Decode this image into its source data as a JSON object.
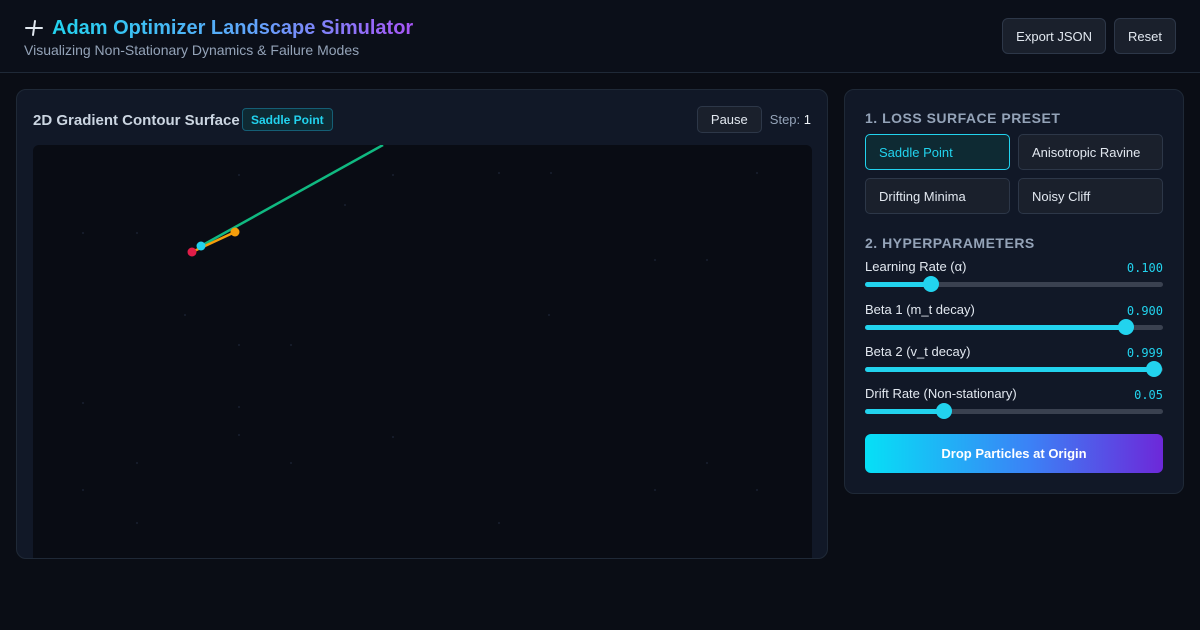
{
  "header": {
    "title": "Adam Optimizer Landscape Simulator",
    "subtitle": "Visualizing Non-Stationary Dynamics & Failure Modes",
    "export_label": "Export JSON",
    "reset_label": "Reset",
    "icon": "plane-icon"
  },
  "canvas_panel": {
    "title": "2D Gradient Contour Surface",
    "badge": "Saddle Point",
    "pause_label": "Pause",
    "step_label": "Step:",
    "step_value": "1"
  },
  "controls": {
    "preset_section_title": "1. LOSS SURFACE PRESET",
    "presets": [
      {
        "label": "Saddle Point",
        "active": true
      },
      {
        "label": "Anisotropic Ravine",
        "active": false
      },
      {
        "label": "Drifting Minima",
        "active": false
      },
      {
        "label": "Noisy Cliff",
        "active": false
      }
    ],
    "hyper_section_title": "2. HYPERPARAMETERS",
    "params": [
      {
        "label": "Learning Rate (α)",
        "value": "0.100",
        "level": 0.22
      },
      {
        "label": "Beta 1 (m_t decay)",
        "value": "0.900",
        "level": 0.876
      },
      {
        "label": "Beta 2 (v_t decay)",
        "value": "0.999",
        "level": 0.97
      },
      {
        "label": "Drift Rate (Non-stationary)",
        "value": "0.05",
        "level": 0.265
      }
    ],
    "drop_label": "Drop Particles at Origin"
  },
  "colors": {
    "accent": "#22d3ee",
    "trail_green": "#10b981",
    "trail_orange": "#f59e0b",
    "particle_red": "#e11d48",
    "particle_cyan": "#22d3ee"
  }
}
